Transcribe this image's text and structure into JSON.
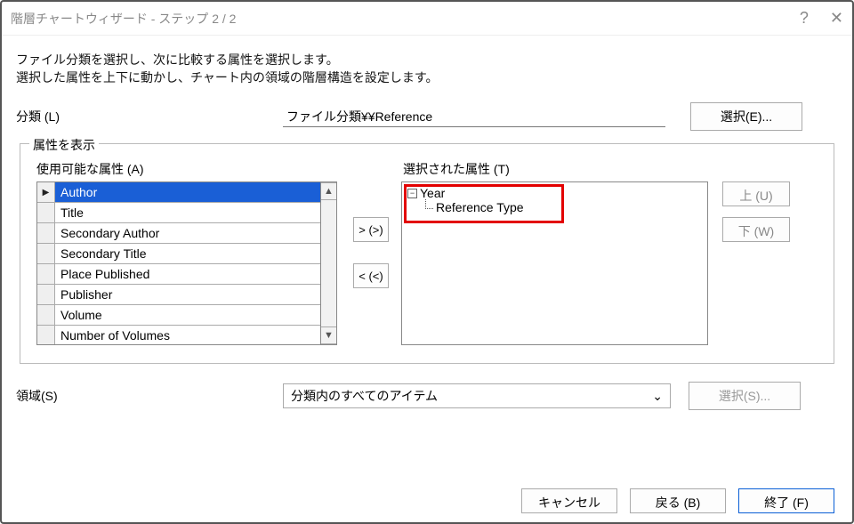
{
  "title": "階層チャートウィザード - ステップ 2 / 2",
  "instructions": [
    "ファイル分類を選択し、次に比較する属性を選択します。",
    "選択した属性を上下に動かし、チャート内の領域の階層構造を設定します。"
  ],
  "classification": {
    "label": "分類 (L)",
    "value": "ファイル分類¥¥Reference",
    "select_button": "選択(E)..."
  },
  "fieldset": {
    "legend": "属性を表示",
    "available_label": "使用可能な属性 (A)",
    "available": [
      "Author",
      "Title",
      "Secondary Author",
      "Secondary Title",
      "Place Published",
      "Publisher",
      "Volume",
      "Number of Volumes"
    ],
    "move_right": "> (>)",
    "move_left": "< (<)",
    "selected_label": "選択された属性 (T)",
    "selected_tree": {
      "root": "Year",
      "child": "Reference Type"
    },
    "up_button": "上 (U)",
    "down_button": "下 (W)"
  },
  "scope": {
    "label": "領域(S)",
    "value": "分類内のすべてのアイテム",
    "select_button": "選択(S)..."
  },
  "footer": {
    "cancel": "キャンセル",
    "back": "戻る (B)",
    "finish": "終了 (F)"
  }
}
